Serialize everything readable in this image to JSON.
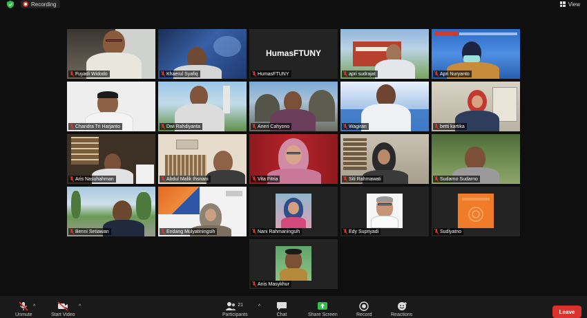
{
  "topbar": {
    "recording_label": "Recording",
    "view_label": "View"
  },
  "participants": [
    {
      "name": "Fuyadi Widodo",
      "muted": true,
      "cam": true
    },
    {
      "name": "Khaerul Syafiq",
      "muted": true,
      "cam": true
    },
    {
      "name": "HumasFTUNY",
      "muted": true,
      "cam": false,
      "display_text": "HumasFTUNY"
    },
    {
      "name": "apri sudrajat",
      "muted": true,
      "cam": true
    },
    {
      "name": "Apri Nuryanto",
      "muted": true,
      "cam": true,
      "active": true
    },
    {
      "name": "Chandra Tri Harjanto",
      "muted": true,
      "cam": true
    },
    {
      "name": "Dwi Rahdiyanta",
      "muted": true,
      "cam": true
    },
    {
      "name": "Aneri Cahyono",
      "muted": true,
      "cam": true
    },
    {
      "name": "Wagiran",
      "muted": true,
      "cam": true
    },
    {
      "name": "betti kartika",
      "muted": true,
      "cam": true
    },
    {
      "name": "Aris Nasuhahman",
      "muted": true,
      "cam": true
    },
    {
      "name": "Abdul Malik Ihsnani",
      "muted": true,
      "cam": true
    },
    {
      "name": "Vita Fitria",
      "muted": true,
      "cam": true
    },
    {
      "name": "Siti Rahmawati",
      "muted": true,
      "cam": true
    },
    {
      "name": "Sudarno Sudarno",
      "muted": true,
      "cam": true
    },
    {
      "name": "Benni Setiawan",
      "muted": true,
      "cam": true
    },
    {
      "name": "Endang Mulyatiningsih",
      "muted": true,
      "cam": true
    },
    {
      "name": "Nani Rahmaningsih",
      "muted": true,
      "cam": false
    },
    {
      "name": "Edy Supriyadi",
      "muted": true,
      "cam": false
    },
    {
      "name": "Sudiyatno",
      "muted": true,
      "cam": false
    },
    {
      "name": "Anis Masykhur",
      "muted": true,
      "cam": false
    }
  ],
  "toolbar": {
    "unmute_label": "Unmute",
    "start_video_label": "Start Video",
    "participants_label": "Participants",
    "participants_count": "21",
    "chat_label": "Chat",
    "share_label": "Share Screen",
    "record_label": "Record",
    "reactions_label": "Reactions",
    "leave_label": "Leave"
  },
  "colors": {
    "active_border": "#e3e53c",
    "leave_bg": "#d9322d",
    "share_green": "#2fbf4a",
    "mute_red": "#e0352f"
  }
}
